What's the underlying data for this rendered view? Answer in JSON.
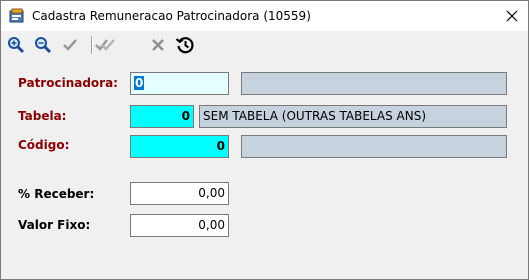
{
  "window": {
    "title": "Cadastra Remuneracao Patrocinadora (10559)"
  },
  "toolbar": {
    "icons": [
      "zoom-in-icon",
      "zoom-out-icon",
      "check-icon",
      "check-all-icon",
      "cancel-icon",
      "history-icon"
    ]
  },
  "form": {
    "patrocinadora": {
      "label": "Patrocinadora:",
      "value": "0",
      "description": ""
    },
    "tabela": {
      "label": "Tabela:",
      "value": "0",
      "description": "SEM TABELA (OUTRAS TABELAS ANS)"
    },
    "codigo": {
      "label": "Código:",
      "value": "0",
      "description": ""
    },
    "percentual_receber": {
      "label": "% Receber:",
      "value": "0,00"
    },
    "valor_fixo": {
      "label": "Valor Fixo:",
      "value": "0,00"
    }
  },
  "colors": {
    "required_label": "#8b0000",
    "key_field_bg": "#00ffff",
    "focused_field_bg": "#e4ffff",
    "readonly_bg": "#c6d3df"
  }
}
